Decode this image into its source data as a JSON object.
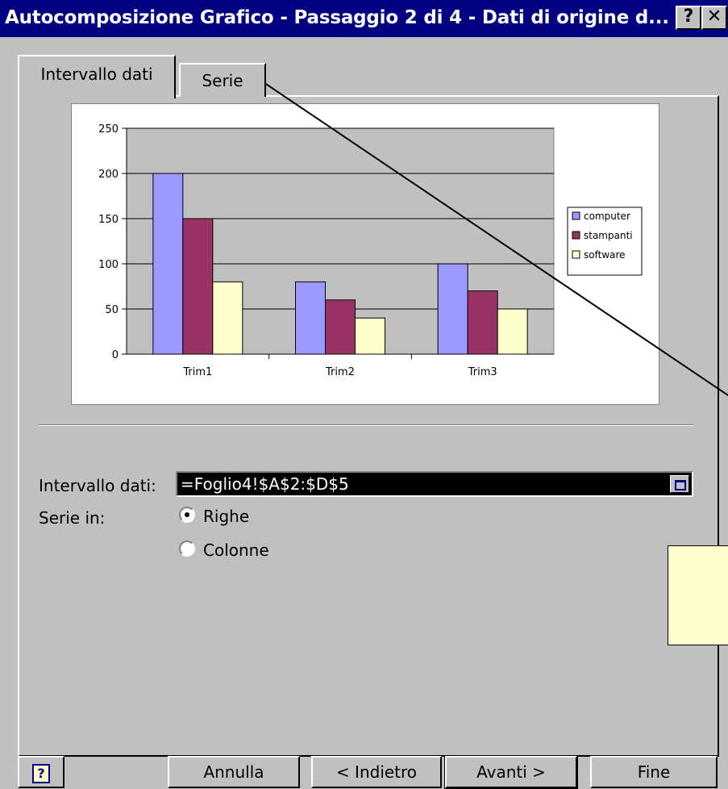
{
  "window": {
    "title": "Autocomposizione Grafico - Passaggio 2 di 4 - Dati di origine d...",
    "help_glyph": "?",
    "close_glyph": "✕"
  },
  "tabs": [
    {
      "label": "Intervallo dati",
      "selected": true
    },
    {
      "label": "Serie",
      "selected": false
    }
  ],
  "form": {
    "range_label": "Intervallo dati:",
    "range_value": "=Foglio4!$A$2:$D$5",
    "series_in_label": "Serie in:",
    "option_rows": "Righe",
    "option_cols": "Colonne",
    "selected_option": "Righe"
  },
  "buttons": {
    "help": "?",
    "cancel": "Annulla",
    "back": "< Indietro",
    "next": "Avanti >",
    "finish": "Fine"
  },
  "colors": {
    "titlebar": "#000080",
    "computer": "#9999ff",
    "stampanti": "#993366",
    "software": "#ffffcc",
    "plot_bg": "#c0c0c0"
  },
  "chart_data": {
    "type": "bar",
    "categories": [
      "Trim1",
      "Trim2",
      "Trim3"
    ],
    "series": [
      {
        "name": "computer",
        "values": [
          200,
          80,
          100
        ]
      },
      {
        "name": "stampanti",
        "values": [
          150,
          60,
          70
        ]
      },
      {
        "name": "software",
        "values": [
          80,
          40,
          50
        ]
      }
    ],
    "ylim": [
      0,
      250
    ],
    "yticks": [
      0,
      50,
      100,
      150,
      200,
      250
    ],
    "grid": true,
    "legend": "right"
  }
}
